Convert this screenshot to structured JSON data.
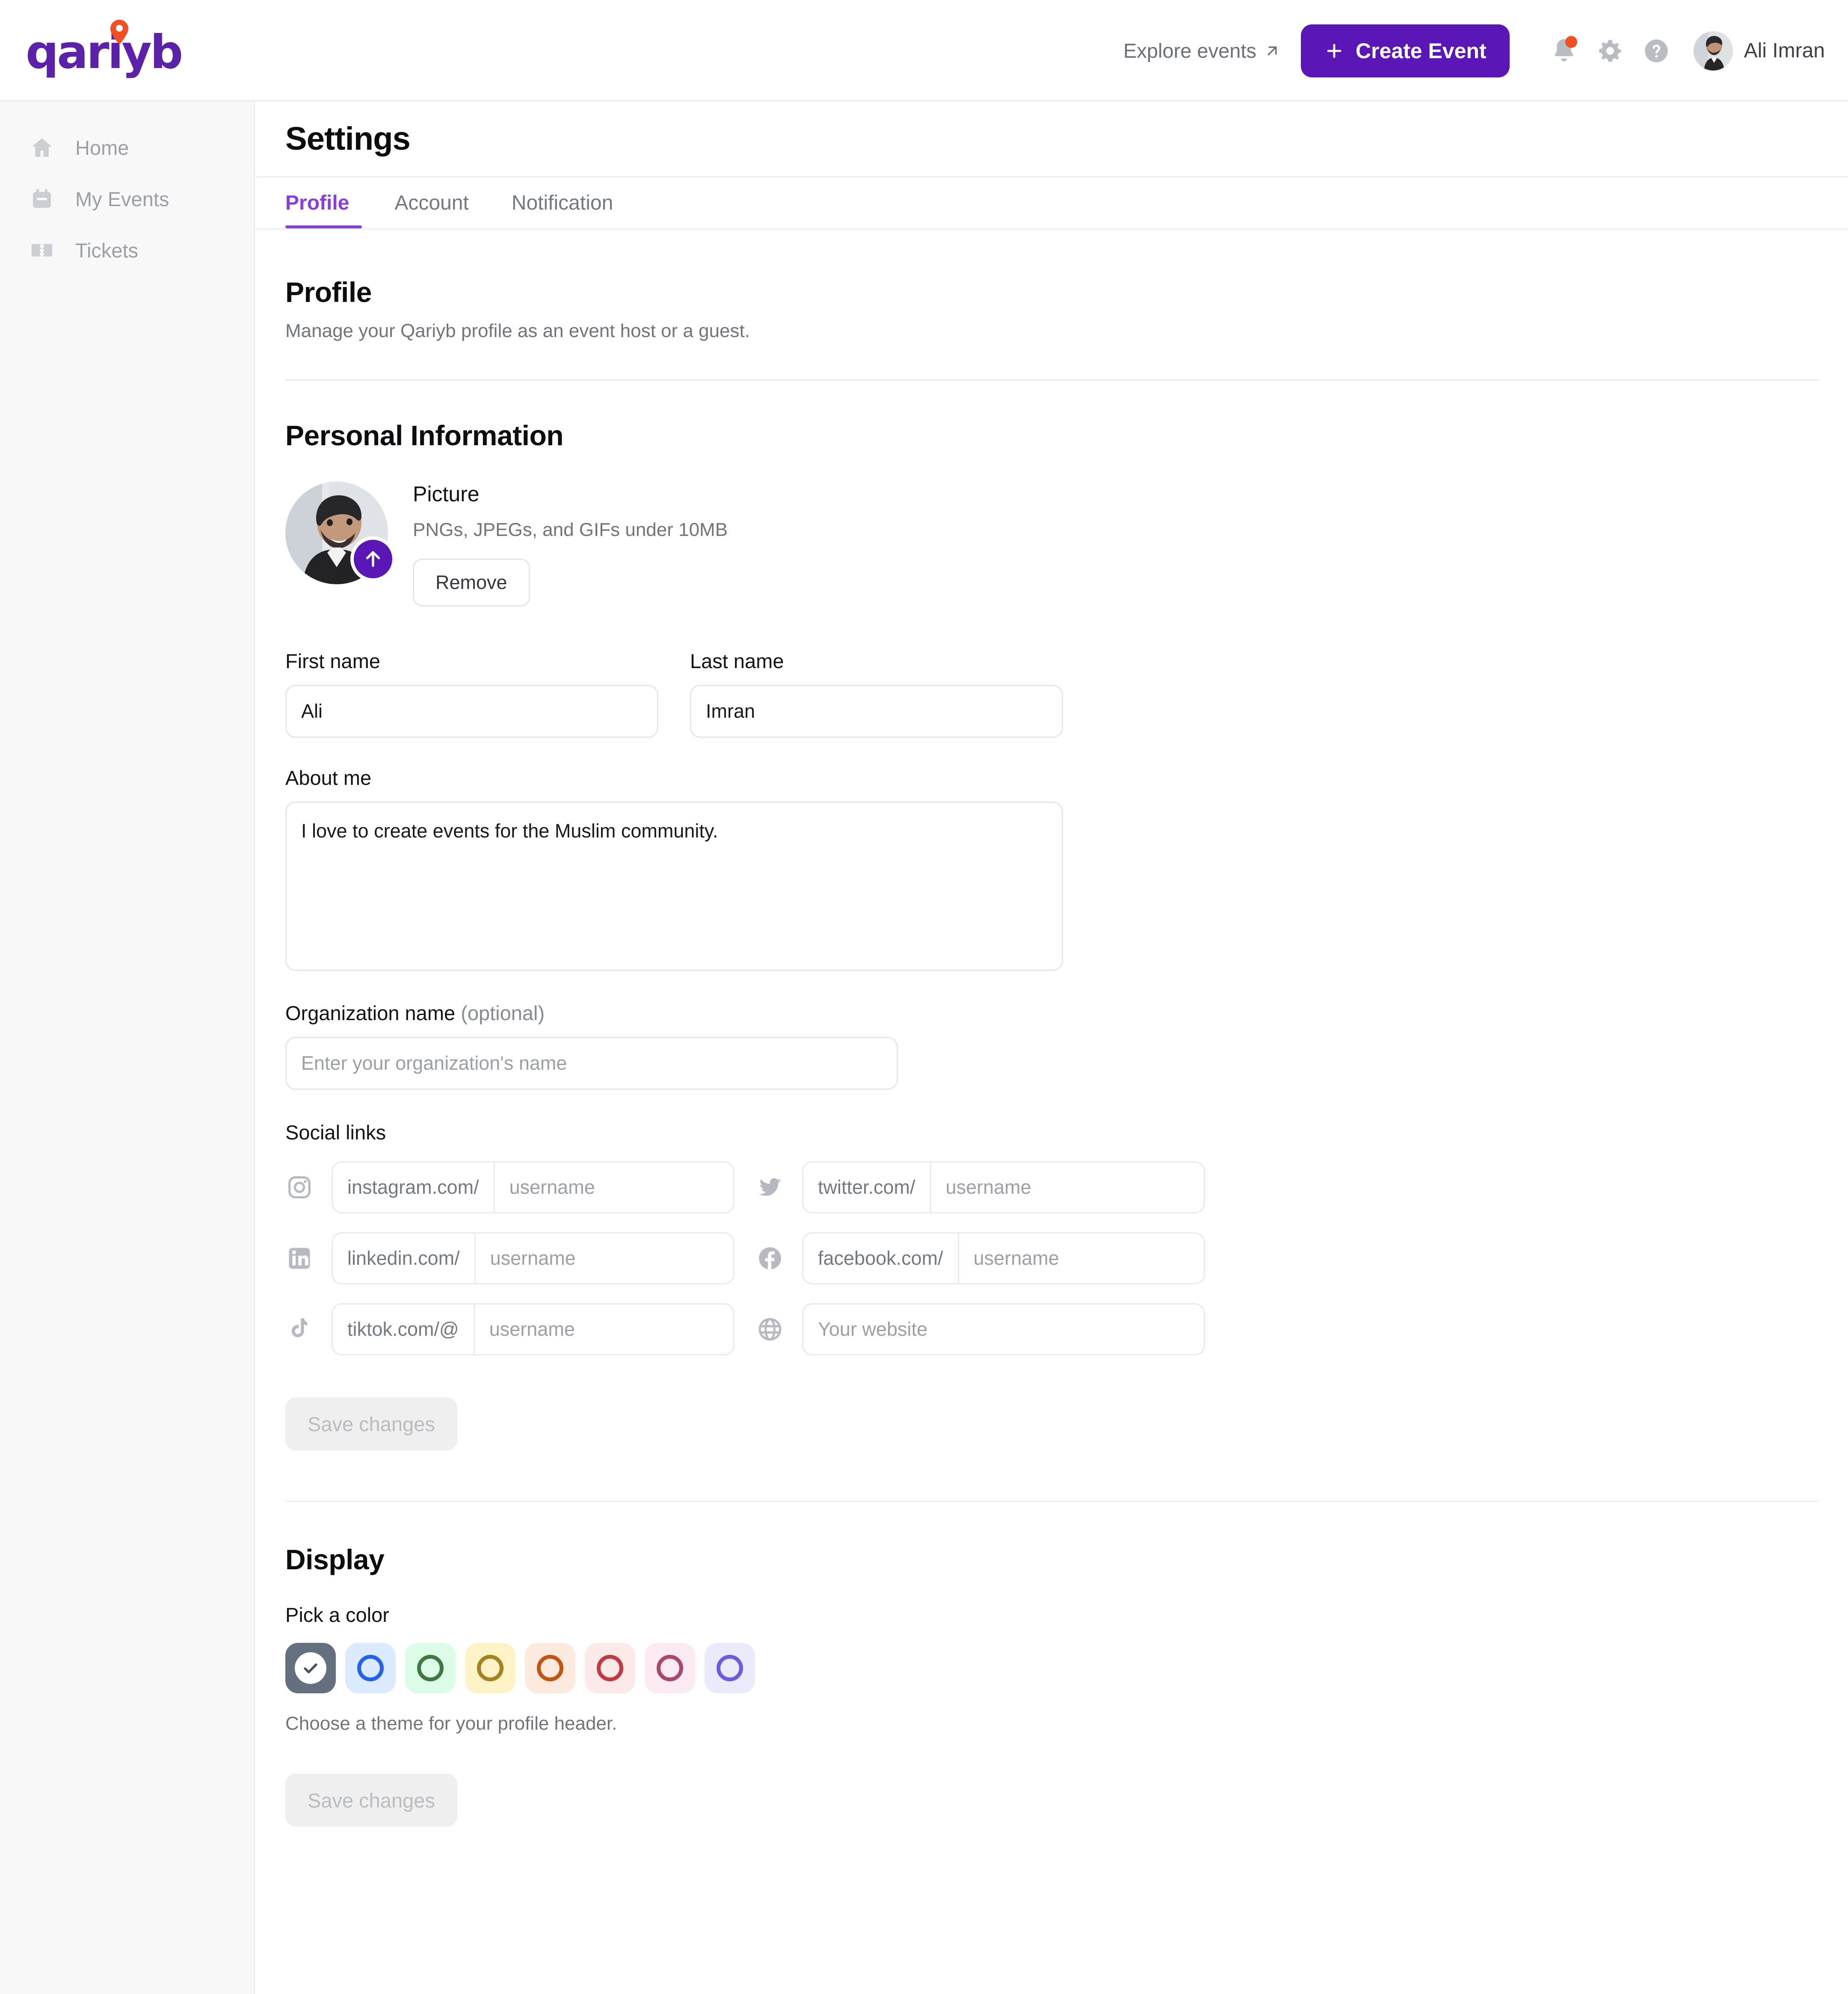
{
  "brand": {
    "name": "qariyb",
    "color": "#5b21a8",
    "pin_color": "#f04e23"
  },
  "topbar": {
    "explore_label": "Explore events",
    "explore_icon": "arrow-up-right-icon",
    "create_label": "Create Event",
    "plus_icon": "plus-icon",
    "notifications_icon": "bell-icon",
    "has_notification_dot": true,
    "settings_icon": "gear-icon",
    "help_icon": "question-circle-icon",
    "user_name": "Ali Imran",
    "avatar_icon": "user-avatar"
  },
  "sidebar": {
    "items": [
      {
        "label": "Home",
        "icon": "home-icon"
      },
      {
        "label": "My Events",
        "icon": "calendar-icon"
      },
      {
        "label": "Tickets",
        "icon": "ticket-icon"
      }
    ]
  },
  "page": {
    "title": "Settings"
  },
  "tabs": [
    {
      "label": "Profile",
      "active": true
    },
    {
      "label": "Account",
      "active": false
    },
    {
      "label": "Notification",
      "active": false
    }
  ],
  "profile": {
    "heading": "Profile",
    "subheading": "Manage your Qariyb profile as an event host or a guest.",
    "personal_info_heading": "Personal Information",
    "picture": {
      "title": "Picture",
      "note": "PNGs, JPEGs, and GIFs under 10MB",
      "upload_icon": "upload-arrow-icon",
      "remove_label": "Remove"
    },
    "first_name": {
      "label": "First name",
      "value": "Ali",
      "placeholder": ""
    },
    "last_name": {
      "label": "Last name",
      "value": "Imran",
      "placeholder": ""
    },
    "about_me": {
      "label": "About me",
      "value": "I love to create events for the Muslim community.",
      "placeholder": ""
    },
    "organization": {
      "label": "Organization name",
      "optional_suffix": "(optional)",
      "value": "",
      "placeholder": "Enter your organization's name"
    },
    "social_links_label": "Social links",
    "social_links": [
      {
        "icon": "instagram-icon",
        "prefix": "instagram.com/",
        "placeholder": "username",
        "value": ""
      },
      {
        "icon": "twitter-icon",
        "prefix": "twitter.com/",
        "placeholder": "username",
        "value": ""
      },
      {
        "icon": "linkedin-icon",
        "prefix": "linkedin.com/",
        "placeholder": "username",
        "value": ""
      },
      {
        "icon": "facebook-icon",
        "prefix": "facebook.com/",
        "placeholder": "username",
        "value": ""
      },
      {
        "icon": "tiktok-icon",
        "prefix": "tiktok.com/@",
        "placeholder": "username",
        "value": ""
      },
      {
        "icon": "globe-icon",
        "prefix": "",
        "placeholder": "Your website",
        "value": ""
      }
    ],
    "save_label": "Save changes",
    "save_disabled": true
  },
  "display": {
    "heading": "Display",
    "pick_color_label": "Pick a color",
    "hint": "Choose a theme for your profile header.",
    "save_label": "Save changes",
    "save_disabled": true,
    "swatches": [
      {
        "name": "slate",
        "bg": "#64707f",
        "ring": "#ffffff",
        "selected": true,
        "check_icon": "check-icon"
      },
      {
        "name": "blue",
        "bg": "#dbeafe",
        "ring": "#2563eb",
        "selected": false
      },
      {
        "name": "green",
        "bg": "#dcfce7",
        "ring": "#3f7a41",
        "selected": false
      },
      {
        "name": "yellow",
        "bg": "#fef3c7",
        "ring": "#a3821f",
        "selected": false
      },
      {
        "name": "orange",
        "bg": "#fceade",
        "ring": "#c2560e",
        "selected": false
      },
      {
        "name": "red",
        "bg": "#fce9e9",
        "ring": "#c13a42",
        "selected": false
      },
      {
        "name": "pink",
        "bg": "#fbeaf2",
        "ring": "#a8486f",
        "selected": false
      },
      {
        "name": "indigo",
        "bg": "#eaeafa",
        "ring": "#6c5ce0",
        "selected": false
      }
    ]
  }
}
